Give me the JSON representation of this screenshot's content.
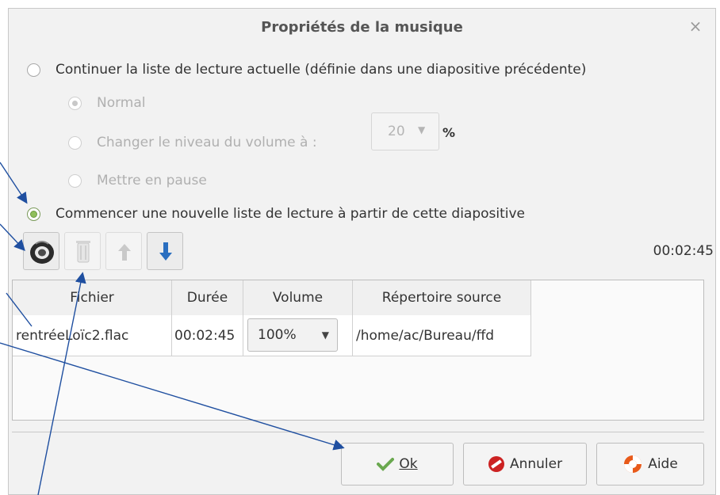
{
  "dialog": {
    "title": "Propriétés de la musique",
    "close_glyph": "×"
  },
  "options": {
    "continue_label": "Continuer la liste de lecture actuelle (définie dans une diapositive précédente)",
    "normal_label": "Normal",
    "volume_label": "Changer le niveau du volume à :",
    "volume_value": "20",
    "volume_unit": "%",
    "pause_label": "Mettre en pause",
    "new_playlist_label": "Commencer une nouvelle liste de lecture à partir de cette diapositive"
  },
  "toolbar": {
    "icons": [
      "speaker-icon",
      "trash-icon",
      "arrow-up-icon",
      "arrow-down-icon"
    ],
    "total_time": "00:02:45"
  },
  "table": {
    "headers": [
      "Fichier",
      "Durée",
      "Volume",
      "Répertoire source"
    ],
    "rows": [
      {
        "file": "rentréeLoïc2.flac",
        "duration": "00:02:45",
        "volume": "100%",
        "source": "/home/ac/Bureau/ffd"
      }
    ]
  },
  "buttons": {
    "ok_label": "Ok",
    "cancel_label": "Annuler",
    "help_label": "Aide"
  },
  "colors": {
    "accent_blue": "#2a6fc0",
    "ok_green": "#6aa84f",
    "cancel_red": "#cc2222",
    "annotation_line": "#1f4fa0"
  }
}
